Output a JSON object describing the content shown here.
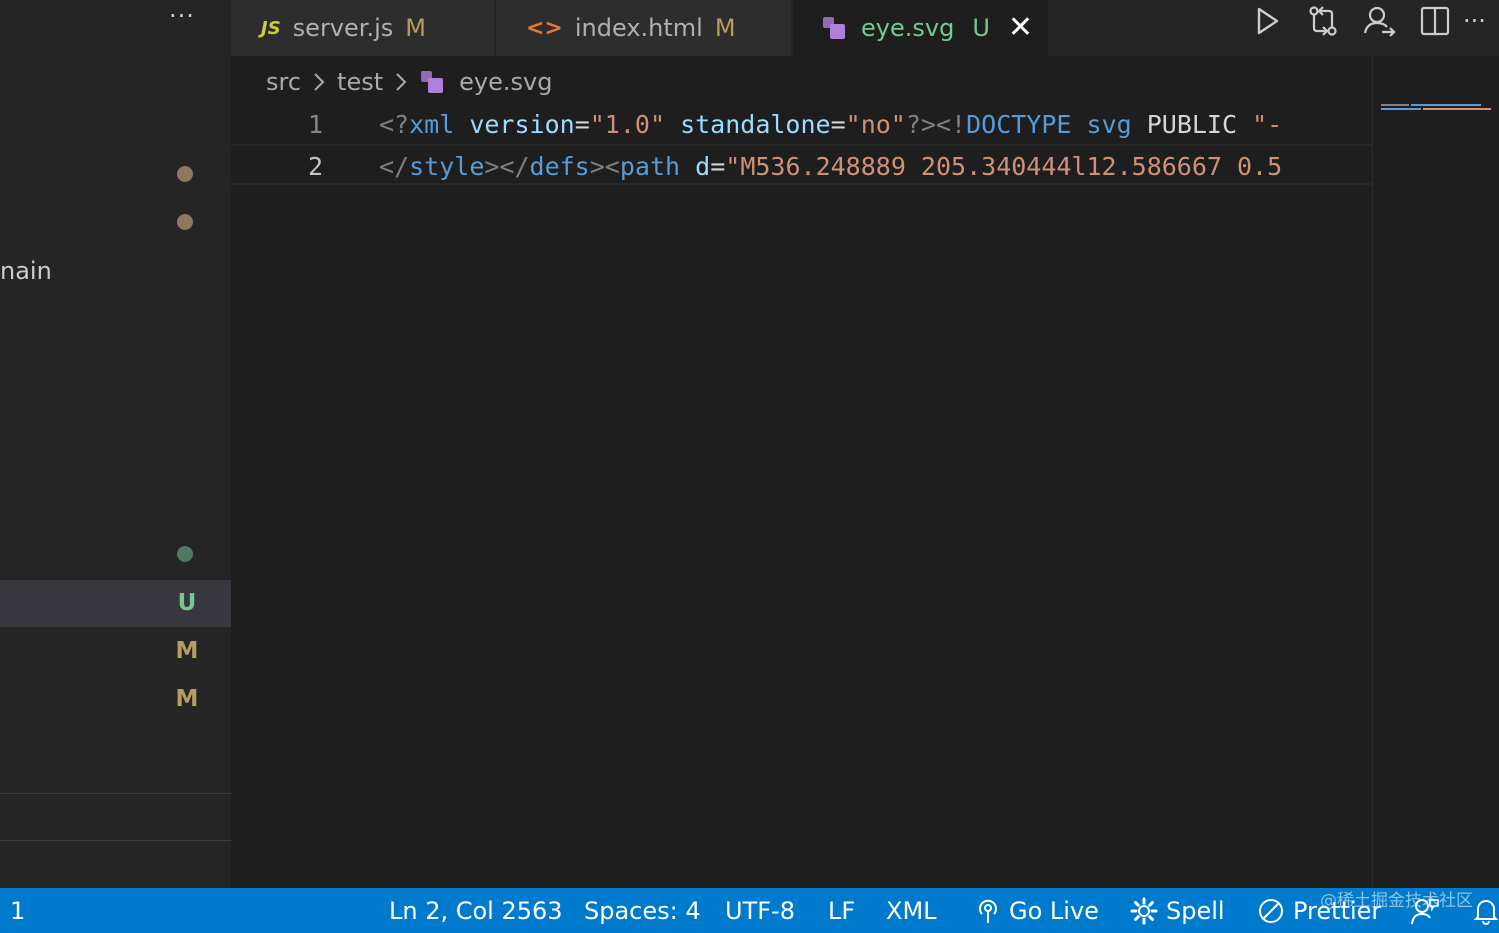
{
  "sidebar": {
    "more_label": "···",
    "branch_fragment": "nain",
    "status_letters": [
      "U",
      "M",
      "M"
    ],
    "colors": {
      "untracked": "#73c991",
      "modified": "#b89b5e",
      "dot_modified": "#8b7a5e",
      "dot_untracked": "#4e7a62"
    }
  },
  "tabs": [
    {
      "icon": "js-file-icon",
      "icon_text": "JS",
      "label": "server.js",
      "status": "M"
    },
    {
      "icon": "html-file-icon",
      "icon_text": "<>",
      "label": "index.html",
      "status": "M"
    },
    {
      "icon": "svg-file-icon",
      "label": "eye.svg",
      "status": "U",
      "active": true,
      "close": "✕"
    }
  ],
  "editor_actions": [
    "run-icon",
    "compare-changes-icon",
    "live-share-icon",
    "split-editor-icon",
    "more-actions-icon"
  ],
  "editor_actions_more": "···",
  "breadcrumb": {
    "parts": [
      "src",
      "test",
      "eye.svg"
    ]
  },
  "code": {
    "lines": [
      {
        "number": "1",
        "tokens": [
          [
            "punc",
            "<?"
          ],
          [
            "tag",
            "xml"
          ],
          [
            "plain",
            " "
          ],
          [
            "attr",
            "version"
          ],
          [
            "eq",
            "="
          ],
          [
            "str",
            "\"1.0\""
          ],
          [
            "plain",
            " "
          ],
          [
            "attr",
            "standalone"
          ],
          [
            "eq",
            "="
          ],
          [
            "str",
            "\"no\""
          ],
          [
            "punc",
            "?><!"
          ],
          [
            "tag",
            "DOCTYPE"
          ],
          [
            "plain",
            " "
          ],
          [
            "tag",
            "svg"
          ],
          [
            "plain",
            " PUBLIC "
          ],
          [
            "str",
            "\"-"
          ]
        ]
      },
      {
        "number": "2",
        "tokens": [
          [
            "punc",
            "</"
          ],
          [
            "tag",
            "style"
          ],
          [
            "punc",
            "></"
          ],
          [
            "tag",
            "defs"
          ],
          [
            "punc",
            "><"
          ],
          [
            "tag",
            "path"
          ],
          [
            "plain",
            " "
          ],
          [
            "attr",
            "d"
          ],
          [
            "eq",
            "="
          ],
          [
            "str",
            "\"M536.248889 205.340444l12.586667 0.5"
          ]
        ]
      }
    ]
  },
  "statusbar": {
    "left": "1",
    "position": "Ln 2, Col 2563",
    "spaces": "Spaces: 4",
    "encoding": "UTF-8",
    "eol": "LF",
    "language": "XML",
    "go_live": "Go Live",
    "spell": "Spell",
    "prettier": "Prettier",
    "watermark": "@稀土掘金技术社区"
  }
}
